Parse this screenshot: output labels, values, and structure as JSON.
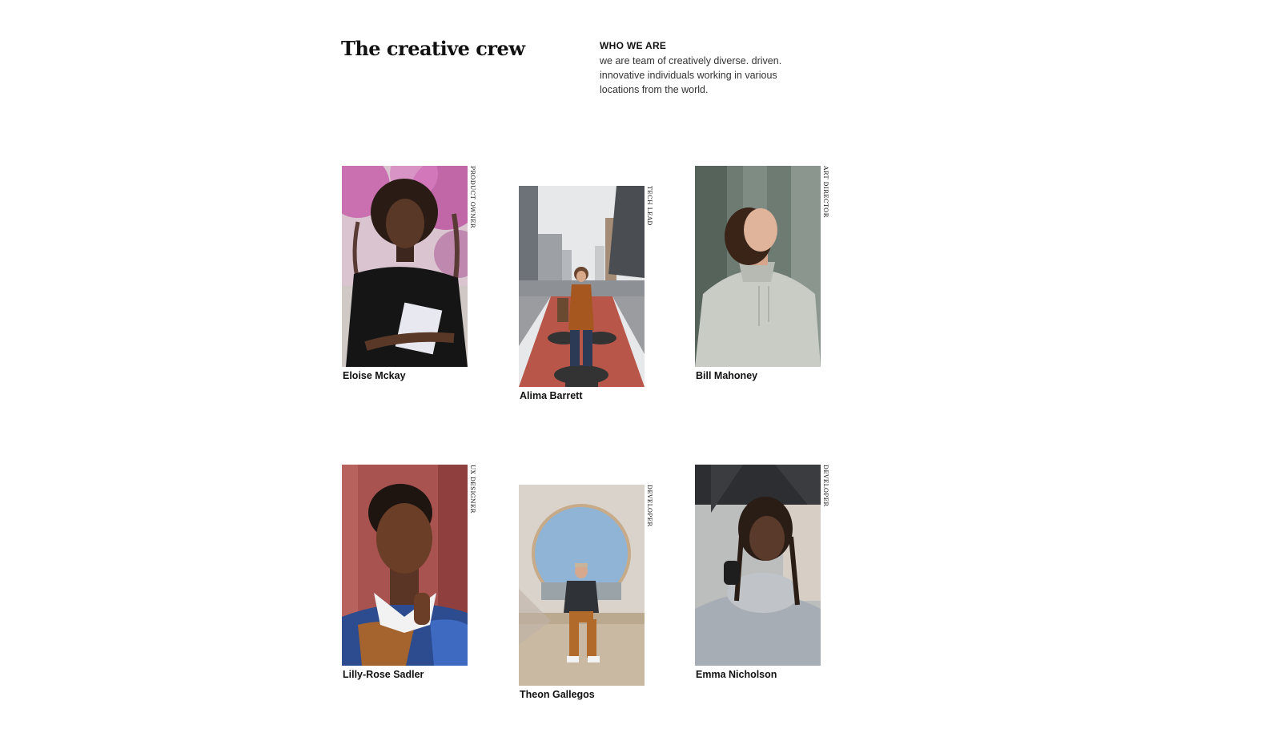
{
  "header": {
    "title": "The creative crew",
    "intro_heading": "WHO WE ARE",
    "intro_text": "we are team of creatively diverse. driven. innovative individuals working in various locations from the world."
  },
  "members": [
    {
      "name": "Eloise Mckay",
      "role": "PRODUCT OWNER",
      "photo": "portrait-woman-with-book-cherry-blossoms"
    },
    {
      "name": "Alima Barrett",
      "role": "TECH LEAD",
      "photo": "portrait-woman-on-city-bike-lane"
    },
    {
      "name": "Bill Mahoney",
      "role": "ART DIRECTOR",
      "photo": "portrait-man-in-grey-hoodie"
    },
    {
      "name": "Lilly-Rose Sadler",
      "role": "UX DESIGNER",
      "photo": "portrait-woman-red-wall"
    },
    {
      "name": "Theon Gallegos",
      "role": "DEVELOPER",
      "photo": "portrait-man-sitting-round-window"
    },
    {
      "name": "Emma Nicholson",
      "role": "DEVELOPER",
      "photo": "portrait-woman-with-scarf-braids"
    }
  ]
}
